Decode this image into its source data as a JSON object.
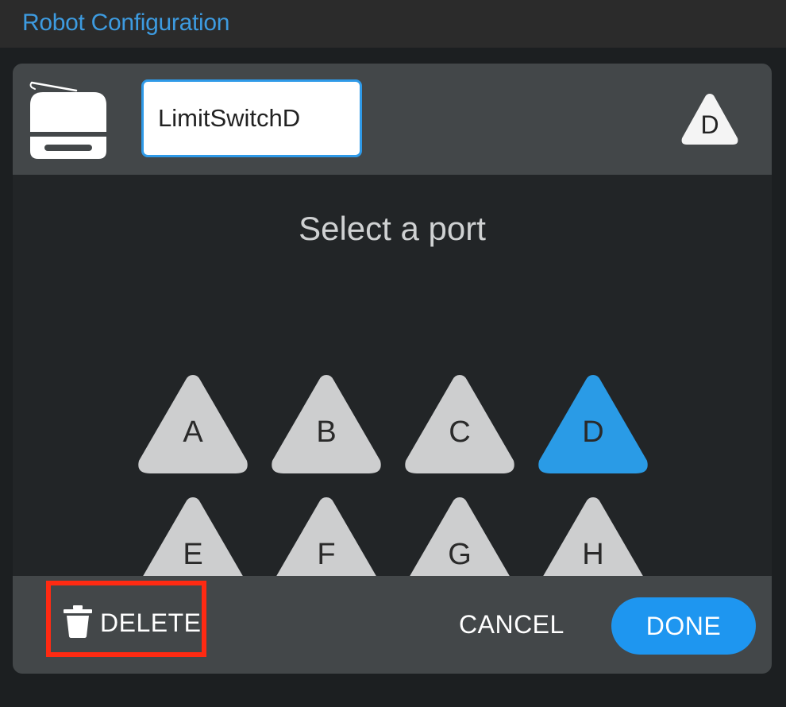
{
  "window": {
    "title": "Robot Configuration"
  },
  "device": {
    "icon": "limit-switch-device-icon",
    "name_value": "LimitSwitchD",
    "selected_port_badge": "D"
  },
  "port_selector": {
    "prompt": "Select a port",
    "ports": [
      "A",
      "B",
      "C",
      "D",
      "E",
      "F",
      "G",
      "H"
    ],
    "selected": "D",
    "colors": {
      "unselected": "#cdcecf",
      "selected": "#2a9be6"
    }
  },
  "footer": {
    "delete_label": "DELETE",
    "delete_icon": "trash-icon",
    "cancel_label": "CANCEL",
    "done_label": "DONE"
  },
  "colors": {
    "accent": "#1e96f0",
    "title": "#3d9be0",
    "highlight_border": "#ff2a12"
  }
}
